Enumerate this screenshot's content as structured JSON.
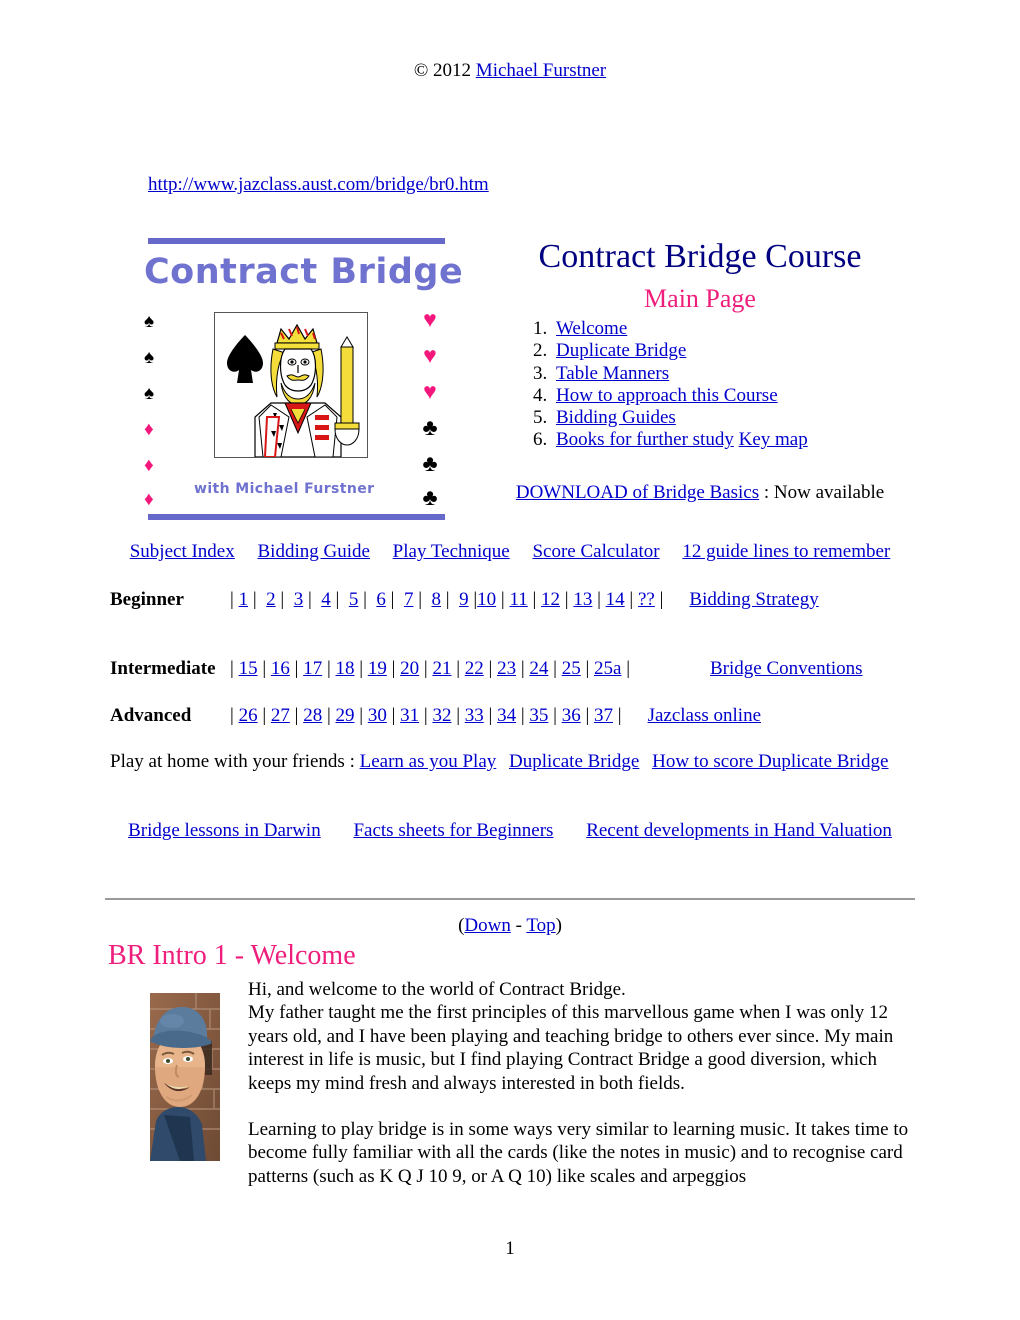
{
  "header": {
    "copyright_prefix": "© 2012 ",
    "copyright_author": "Michael Furstner",
    "url": "http://www.jazclass.aust.com/bridge/br0.htm"
  },
  "logo": {
    "title": "Contract Bridge",
    "byline": "with Michael Furstner",
    "card_name": "king-of-spades",
    "bar_color": "#6668CA",
    "title_color": "#6F72CF",
    "left_suits": [
      "spade",
      "spade",
      "spade",
      "diamond",
      "diamond",
      "diamond"
    ],
    "right_suits": [
      "heart",
      "heart",
      "heart",
      "club",
      "club",
      "club"
    ],
    "heart_color": "#F5187C",
    "club_color": "#000000"
  },
  "main": {
    "title": "Contract Bridge Course",
    "title_color": "#000080",
    "subtitle": "Main Page",
    "subtitle_color": "#EF1E7C",
    "toc": [
      {
        "label": "Welcome"
      },
      {
        "label": "Duplicate Bridge"
      },
      {
        "label": "Table Manners"
      },
      {
        "label": "How to approach this Course"
      },
      {
        "label": "Bidding Guides"
      },
      {
        "label": "Books for further study",
        "extra": "Key map"
      }
    ],
    "download": {
      "link": "DOWNLOAD of Bridge Basics",
      "suffix": " : Now available"
    }
  },
  "quicklinks": [
    "Subject Index",
    "Bidding Guide",
    "Play Technique",
    "Score Calculator",
    "12 guide lines to remember"
  ],
  "levels": [
    {
      "name": "Beginner",
      "numbers": [
        "1",
        "2",
        "3",
        "4",
        "5",
        "6",
        "7",
        "8",
        "9",
        "10",
        "11",
        "12",
        "13",
        "14",
        "??"
      ],
      "side_link": "Bidding Strategy"
    },
    {
      "name": "Intermediate",
      "numbers": [
        "15",
        "16",
        "17",
        "18",
        "19",
        "20",
        "21",
        "22",
        "23",
        "24",
        "25",
        "25a"
      ],
      "side_link": "Bridge Conventions"
    },
    {
      "name": "Advanced",
      "numbers": [
        "26",
        "27",
        "28",
        "29",
        "30",
        "31",
        "32",
        "33",
        "34",
        "35",
        "36",
        "37"
      ],
      "side_link": "Jazclass online"
    }
  ],
  "playhome": {
    "intro": "Play at home with your friends : ",
    "links": [
      "Learn as you Play",
      "Duplicate Bridge",
      "How to score Duplicate Bridge"
    ]
  },
  "lessons": [
    "Bridge lessons in Darwin",
    "Facts sheets for Beginners",
    "Recent developments in Hand Valuation"
  ],
  "section": {
    "down_open": "(",
    "down": "Down",
    "down_sep": " - ",
    "top": "Top",
    "down_close": ")",
    "heading": "BR Intro 1 - Welcome"
  },
  "body": {
    "para1_line1": "Hi, and welcome to the world of Contract Bridge.",
    "para1_line2": "My father taught me the first principles of this marvellous game when I was only 12 years old, and I have been playing and teaching bridge to others ever since. My main interest in life is music, but I find playing Contract Bridge a good diversion, which keeps my mind fresh and always interested in both fields.",
    "para2": "Learning to play bridge is in some ways very similar to learning music. It takes time to become fully familiar with all the cards (like the notes in music) and to recognise card patterns (such as K Q J 10 9, or A Q 10) like scales and arpeggios"
  },
  "footer": {
    "page_number": "1"
  }
}
